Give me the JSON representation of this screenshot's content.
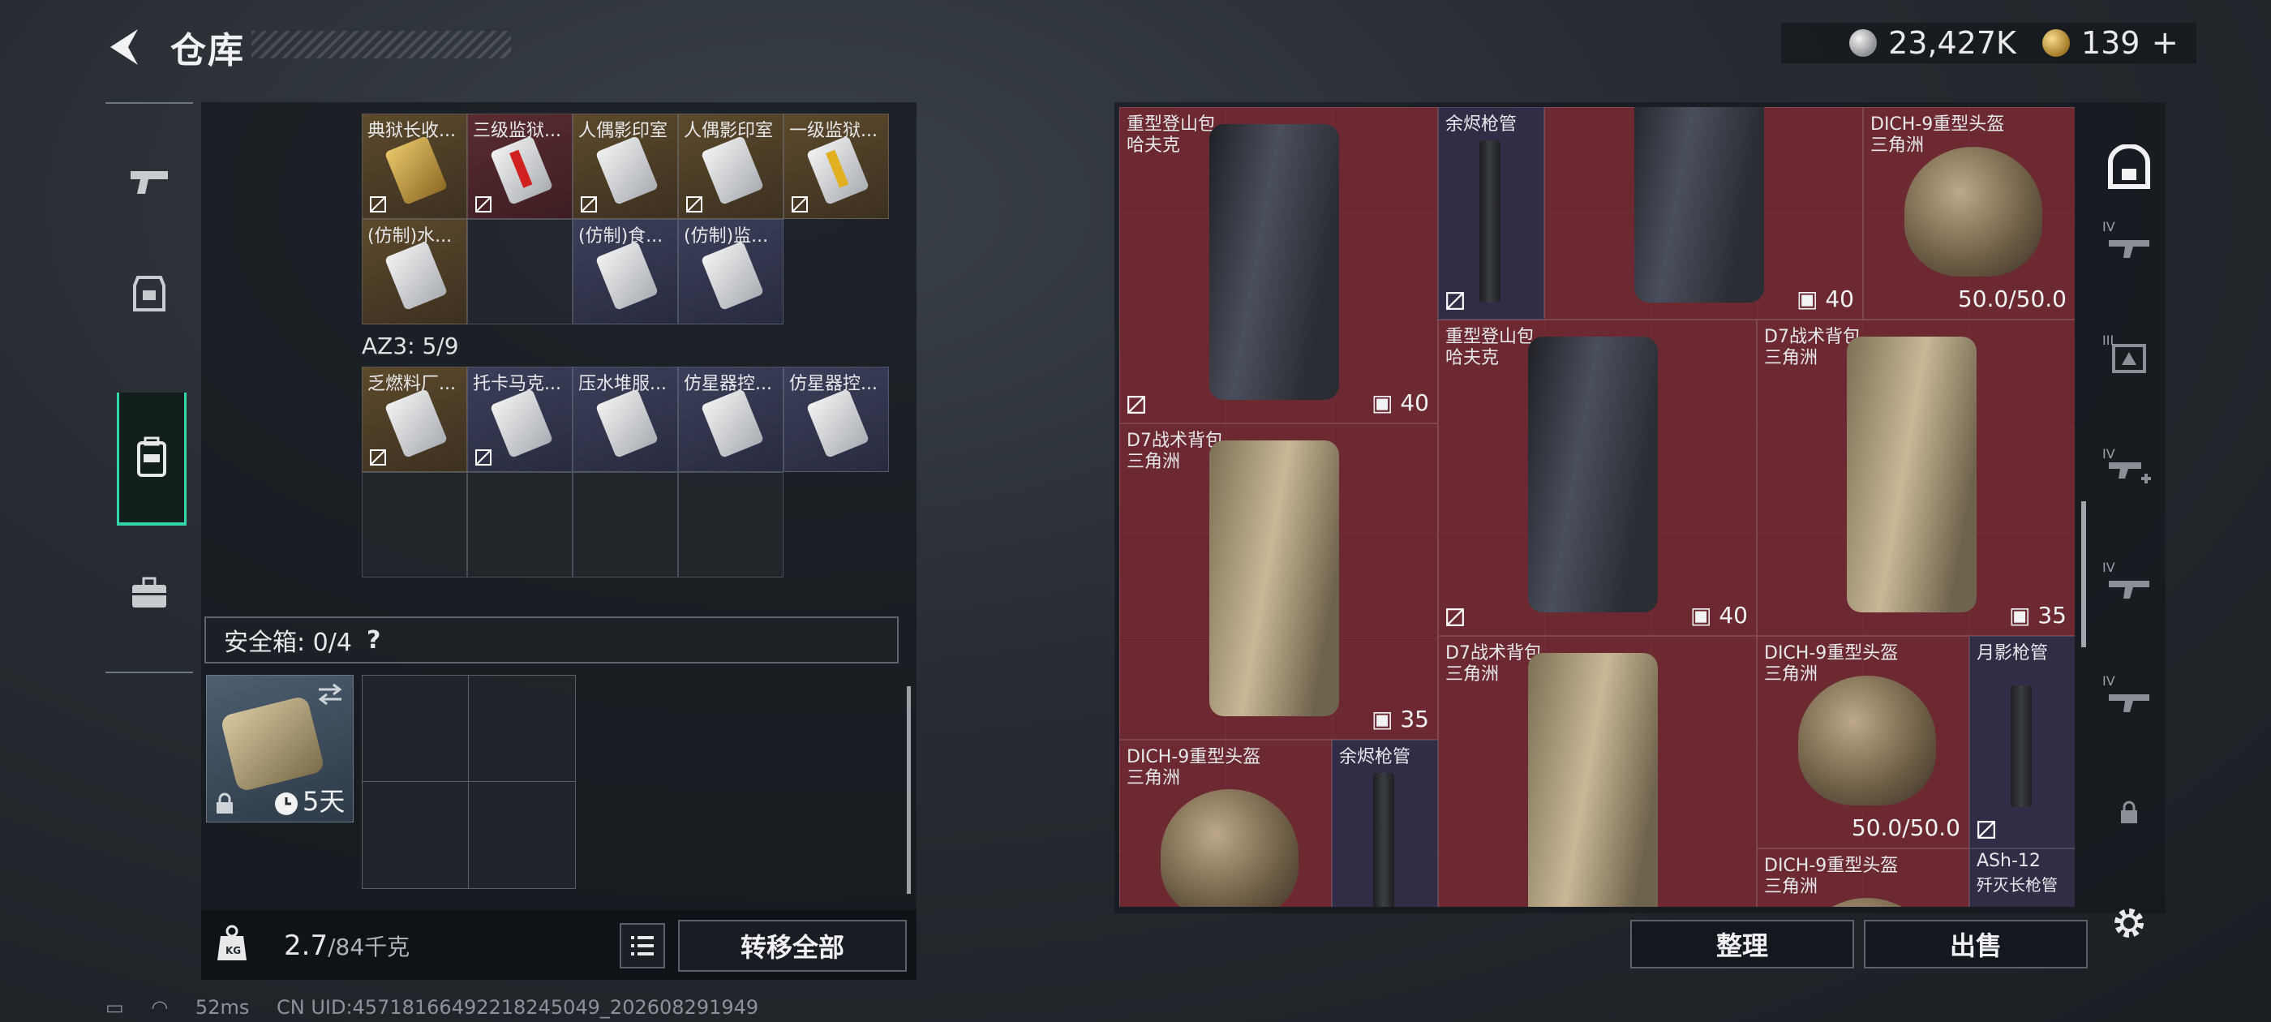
{
  "header": {
    "title": "仓库",
    "silver": "23,427K",
    "gold": "139"
  },
  "left_nav": [
    "pistol-icon",
    "armor-icon",
    "backpack-icon",
    "toolbox-icon"
  ],
  "container_top": {
    "row1": [
      {
        "label": "典狱长收...",
        "tone": "gold"
      },
      {
        "label": "三级监狱...",
        "tone": "red"
      },
      {
        "label": "人偶影印室",
        "tone": "gold"
      },
      {
        "label": "人偶影印室",
        "tone": "gold"
      },
      {
        "label": "一级监狱...",
        "tone": "gold"
      }
    ],
    "row2": [
      {
        "label": "(仿制)水...",
        "tone": "gold"
      },
      {
        "label": "",
        "tone": "empty"
      },
      {
        "label": "(仿制)食...",
        "tone": "blue"
      },
      {
        "label": "(仿制)监...",
        "tone": "blue"
      }
    ]
  },
  "az3": {
    "label": "AZ3: 5/9"
  },
  "container_az3": {
    "row1": [
      {
        "label": "乏燃料厂...",
        "tone": "gold"
      },
      {
        "label": "托卡马克...",
        "tone": "blue"
      },
      {
        "label": "压水堆服...",
        "tone": "blue"
      },
      {
        "label": "仿星器控...",
        "tone": "blue"
      },
      {
        "label": "仿星器控...",
        "tone": "blue"
      }
    ]
  },
  "safe_box": {
    "label": "安全箱:  0/4",
    "help": "?",
    "timer": "5天"
  },
  "weight": {
    "current": "2.7",
    "max": "/84千克"
  },
  "buttons": {
    "transfer_all": "转移全部",
    "organize": "整理",
    "sell": "出售"
  },
  "footer": {
    "ping": "52ms",
    "uid": "CN UID:457181664922182450​49_202608291949"
  },
  "inventory": [
    {
      "name": "重型登山包",
      "sub": "哈夫克",
      "count": "40",
      "kind": "bag-dark",
      "tone": "red"
    },
    {
      "name": "余烬枪管",
      "sub": "",
      "count": "",
      "kind": "barrel",
      "tone": "blue"
    },
    {
      "name": "",
      "sub": "",
      "count": "40",
      "kind": "bag-dark",
      "tone": "red"
    },
    {
      "name": "DICH-9重型头盔",
      "sub": "三角洲",
      "durability": "50.0/50.0",
      "kind": "helmet",
      "tone": "red"
    },
    {
      "name": "重型登山包",
      "sub": "哈夫克",
      "count": "40",
      "kind": "bag-dark",
      "tone": "red"
    },
    {
      "name": "D7战术背包",
      "sub": "三角洲",
      "count": "35",
      "kind": "bag-tan",
      "tone": "red"
    },
    {
      "name": "D7战术背包",
      "sub": "三角洲",
      "count": "35",
      "kind": "bag-tan",
      "tone": "red"
    },
    {
      "name": "D7战术背包",
      "sub": "三角洲",
      "count": "",
      "kind": "bag-tan",
      "tone": "red"
    },
    {
      "name": "DICH-9重型头盔",
      "sub": "三角洲",
      "durability": "50.0/50.0",
      "kind": "helmet",
      "tone": "red"
    },
    {
      "name": "月影枪管",
      "sub": "",
      "count": "",
      "kind": "barrel",
      "tone": "blue"
    },
    {
      "name": "DICH-9重型头盔",
      "sub": "三角洲",
      "count": "",
      "kind": "helmet",
      "tone": "red"
    },
    {
      "name": "余烬枪管",
      "sub": "",
      "count": "",
      "kind": "barrel",
      "tone": "blue"
    },
    {
      "name": "DICH-9重型头盔",
      "sub": "三角洲",
      "count": "",
      "kind": "helmet",
      "tone": "red"
    },
    {
      "name": "ASh-12",
      "sub": "歼灭长枪管",
      "count": "",
      "kind": "barrel",
      "tone": "blue"
    }
  ],
  "right_nav": [
    "backpack-icon",
    "rifle-iv-icon",
    "armor-iii-icon",
    "rifle-iv-plus-icon",
    "rifle-iv-icon",
    "rifle-iv-icon",
    "lock-icon",
    "settings-icon"
  ],
  "right_nav_tiers": [
    "IV",
    "III",
    "IV",
    "IV",
    "IV"
  ]
}
